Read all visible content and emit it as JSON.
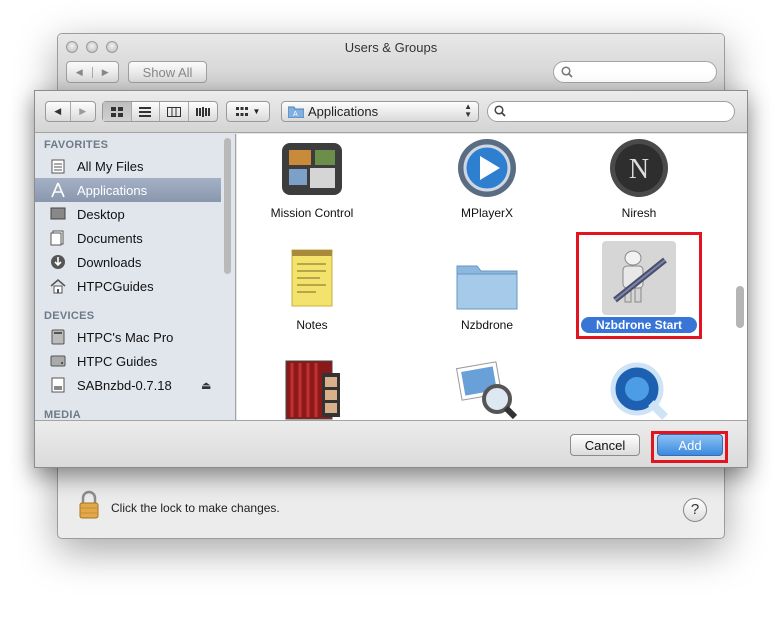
{
  "background_window": {
    "title": "Users & Groups",
    "nav_back": "◀",
    "nav_forward": "▶",
    "show_all_label": "Show All",
    "lock_text": "Click the lock to make changes.",
    "help_label": "?"
  },
  "dialog": {
    "toolbar": {
      "back": "◀",
      "forward": "▶",
      "location": "Applications",
      "search_value": "",
      "search_placeholder": ""
    },
    "sidebar": {
      "favorites_header": "FAVORITES",
      "favorites": [
        {
          "label": "All My Files",
          "icon": "all-files-icon"
        },
        {
          "label": "Applications",
          "icon": "applications-icon",
          "selected": true
        },
        {
          "label": "Desktop",
          "icon": "desktop-icon"
        },
        {
          "label": "Documents",
          "icon": "documents-icon"
        },
        {
          "label": "Downloads",
          "icon": "downloads-icon"
        },
        {
          "label": "HTPCGuides",
          "icon": "home-icon"
        }
      ],
      "devices_header": "DEVICES",
      "devices": [
        {
          "label": "HTPC's Mac Pro",
          "icon": "computer-icon"
        },
        {
          "label": "HTPC Guides",
          "icon": "disk-icon"
        },
        {
          "label": "SABnzbd-0.7.18",
          "icon": "disk-image-icon",
          "eject": "⏏"
        }
      ],
      "media_header": "MEDIA"
    },
    "files": [
      {
        "name": "Mission Control",
        "icon": "mission-control-icon"
      },
      {
        "name": "MPlayerX",
        "icon": "mplayerx-icon"
      },
      {
        "name": "Niresh",
        "icon": "niresh-icon"
      },
      {
        "name": "Notes",
        "icon": "notes-icon"
      },
      {
        "name": "Nzbdrone",
        "icon": "folder-icon"
      },
      {
        "name": "Nzbdrone Start",
        "icon": "automator-icon",
        "selected": true
      },
      {
        "name": "",
        "icon": "photo-booth-icon"
      },
      {
        "name": "",
        "icon": "preview-icon"
      },
      {
        "name": "",
        "icon": "quicktime-icon"
      }
    ],
    "buttons": {
      "cancel": "Cancel",
      "add": "Add"
    }
  },
  "colors": {
    "highlight_red": "#e2141f",
    "selection_blue": "#3875d7",
    "sidebar_selected": "#8f9db3"
  }
}
